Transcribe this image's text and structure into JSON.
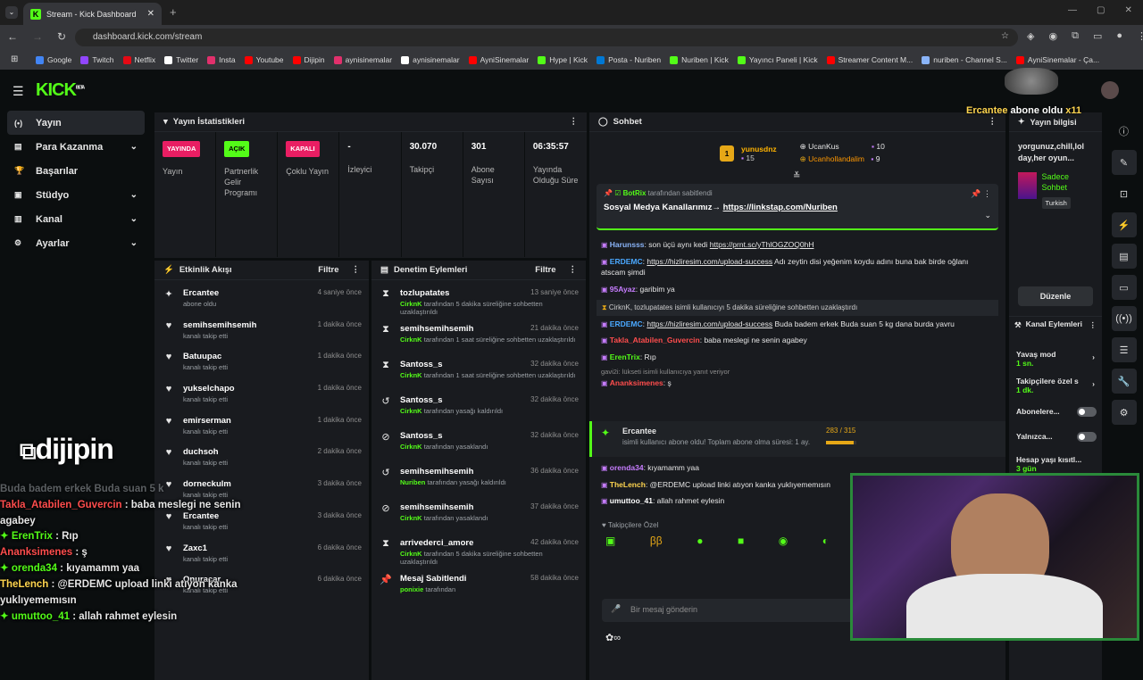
{
  "browser": {
    "tab_title": "Stream - Kick Dashboard",
    "url": "dashboard.kick.com/stream",
    "bookmarks": [
      {
        "label": "Google",
        "color": "#4285f4"
      },
      {
        "label": "Twitch",
        "color": "#9146ff"
      },
      {
        "label": "Netflix",
        "color": "#e50914"
      },
      {
        "label": "Twitter",
        "color": "#ffffff"
      },
      {
        "label": "Insta",
        "color": "#e1306c"
      },
      {
        "label": "Youtube",
        "color": "#ff0000"
      },
      {
        "label": "Dijipin",
        "color": "#ff0000"
      },
      {
        "label": "aynisinemalar",
        "color": "#e1306c"
      },
      {
        "label": "aynisinemalar",
        "color": "#ffffff"
      },
      {
        "label": "AyniSinemalar",
        "color": "#ff0000"
      },
      {
        "label": "Hype | Kick",
        "color": "#53fc18"
      },
      {
        "label": "Posta - Nuriben",
        "color": "#0078d4"
      },
      {
        "label": "Nuriben | Kick",
        "color": "#53fc18"
      },
      {
        "label": "Yayıncı Paneli | Kick",
        "color": "#53fc18"
      },
      {
        "label": "Streamer Content M...",
        "color": "#ff0000"
      },
      {
        "label": "nuriben - Channel S...",
        "color": "#8ab4f8"
      },
      {
        "label": "AyniSinemalar - Ça...",
        "color": "#ff0000"
      }
    ]
  },
  "app": {
    "logo": "KICK",
    "logo_sup": "BETA"
  },
  "sidebar": {
    "items": [
      {
        "label": "Yayın",
        "icon": "(•)",
        "active": true,
        "chevron": false
      },
      {
        "label": "Para Kazanma",
        "icon": "▤",
        "active": false,
        "chevron": true
      },
      {
        "label": "Başarılar",
        "icon": "🏆",
        "active": false,
        "chevron": false
      },
      {
        "label": "Stüdyo",
        "icon": "▣",
        "active": false,
        "chevron": true
      },
      {
        "label": "Kanal",
        "icon": "▥",
        "active": false,
        "chevron": true
      },
      {
        "label": "Ayarlar",
        "icon": "⚙",
        "active": false,
        "chevron": true
      }
    ]
  },
  "stats": {
    "title": "Yayın İstatistikleri",
    "cols": [
      {
        "badge": "YAYINDA",
        "badge_color": "#e91e63",
        "label": "Yayın"
      },
      {
        "badge": "AÇIK",
        "badge_color": "#53fc18",
        "label": "Partnerlik Gelir Programı"
      },
      {
        "badge": "KAPALI",
        "badge_color": "#e91e63",
        "label": "Çoklu Yayın"
      },
      {
        "value": "-",
        "label": "İzleyici"
      },
      {
        "value": "30.070",
        "label": "Takipçi"
      },
      {
        "value": "301",
        "label": "Abone Sayısı"
      },
      {
        "value": "06:35:57",
        "label": "Yayında Olduğu Süre"
      }
    ]
  },
  "activity": {
    "title": "Etkinlik Akışı",
    "filter": "Filtre",
    "rows": [
      {
        "name": "Ercantee",
        "sub": "abone oldu",
        "time": "4 saniye önce",
        "icon": "✦"
      },
      {
        "name": "semihsemihsemih",
        "sub": "kanalı takip etti",
        "time": "1 dakika önce",
        "icon": "♥"
      },
      {
        "name": "Batuupac",
        "sub": "kanalı takip etti",
        "time": "1 dakika önce",
        "icon": "♥"
      },
      {
        "name": "yukselchapo",
        "sub": "kanalı takip etti",
        "time": "1 dakika önce",
        "icon": "♥"
      },
      {
        "name": "emirserman",
        "sub": "kanalı takip etti",
        "time": "1 dakika önce",
        "icon": "♥"
      },
      {
        "name": "duchsoh",
        "sub": "kanalı takip etti",
        "time": "2 dakika önce",
        "icon": "♥"
      },
      {
        "name": "dorneckulm",
        "sub": "kanalı takip etti",
        "time": "3 dakika önce",
        "icon": "♥"
      },
      {
        "name": "Ercantee",
        "sub": "kanalı takip etti",
        "time": "3 dakika önce",
        "icon": "♥"
      },
      {
        "name": "Zaxc1",
        "sub": "kanalı takip etti",
        "time": "6 dakika önce",
        "icon": "♥"
      },
      {
        "name": "Onuracar",
        "sub": "kanalı takip etti",
        "time": "6 dakika önce",
        "icon": "♥"
      }
    ]
  },
  "mod": {
    "title": "Denetim Eylemleri",
    "filter": "Filtre",
    "rows": [
      {
        "name": "tozlupatates",
        "actor": "CirknK",
        "sub": "tarafından 5 dakika süreliğine sohbetten uzaklaştırıldı",
        "time": "13 saniye önce",
        "icon": "⧗"
      },
      {
        "name": "semihsemihsemih",
        "actor": "CirknK",
        "sub": "tarafından 1 saat süreliğine sohbetten uzaklaştırıldı",
        "time": "21 dakika önce",
        "icon": "⧗"
      },
      {
        "name": "Santoss_s",
        "actor": "CirknK",
        "sub": "tarafından 1 saat süreliğine sohbetten uzaklaştırıldı",
        "time": "32 dakika önce",
        "icon": "⧗"
      },
      {
        "name": "Santoss_s",
        "actor": "CirknK",
        "sub": "tarafından yasağı kaldırıldı",
        "time": "32 dakika önce",
        "icon": "↺"
      },
      {
        "name": "Santoss_s",
        "actor": "CirknK",
        "sub": "tarafından yasaklandı",
        "time": "32 dakika önce",
        "icon": "⊘"
      },
      {
        "name": "semihsemihsemih",
        "actor": "Nuriben",
        "sub": "tarafından yasağı kaldırıldı",
        "time": "36 dakika önce",
        "icon": "↺"
      },
      {
        "name": "semihsemihsemih",
        "actor": "CirknK",
        "sub": "tarafından yasaklandı",
        "time": "37 dakika önce",
        "icon": "⊘"
      },
      {
        "name": "arrivederci_amore",
        "actor": "CirknK",
        "sub": "tarafından 5 dakika süreliğine sohbetten uzaklaştırıldı",
        "time": "42 dakika önce",
        "icon": "⧗"
      },
      {
        "name": "Mesaj Sabitlendi",
        "actor": "ponixie",
        "sub": "tarafından",
        "time": "58 dakika önce",
        "icon": "📌"
      }
    ]
  },
  "chat": {
    "title": "Sohbet",
    "gifter1_rank": "1",
    "gifter1_name": "yunusdnz",
    "gifter1_count": "15",
    "gifter2_name": "UcanKus",
    "gifter2_count": "10",
    "gifter3_name": "Ucanhollandalim",
    "gifter3_count": "9",
    "pin_user": "BotRix",
    "pin_by": "tarafından sabitlendi",
    "pin_text": "Sosyal Medya Kanallarımız→ ",
    "pin_link": "https://linkstap.com/Nuriben",
    "messages": [
      {
        "user": "Harunsss",
        "color": "#8ab4f8",
        "text": ": son üçü aynı kedi ",
        "link": "https://prnt.sc/yThlOGZOQ0hH"
      },
      {
        "user": "ERDEMC",
        "color": "#4aa8ff",
        "text": ": ",
        "link": "https://hizliresim.com/upload-success",
        "after": " Adı zeytin disi yeğenim koydu adını buna bak birde oğlanı atscam şimdi"
      },
      {
        "user": "95Ayaz",
        "color": "#c77dff",
        "text": ": garibim ya"
      },
      {
        "sys": "CirknK, tozlupatates isimli kullanıcıyı 5 dakika süreliğine sohbetten uzaklaştırdı"
      },
      {
        "user": "ERDEMC",
        "color": "#4aa8ff",
        "text": ": ",
        "link": "https://hizliresim.com/upload-success",
        "after": " Buda badem erkek Buda suan 5 kg dana burda yavru"
      },
      {
        "user": "Takla_Atabilen_Guvercin",
        "color": "#ff4d4d",
        "text": ": baba meslegi ne senin agabey"
      },
      {
        "user": "ErenTrix",
        "color": "#53fc18",
        "text": ": Rıp"
      },
      {
        "reply": "gavi2i: lükseti isimli kullanıcıya yanıt veriyor"
      },
      {
        "user": "Ananksimenes",
        "color": "#ff4d4d",
        "text": ": ş"
      }
    ],
    "sub_user": "Ercantee",
    "sub_text": "isimli kullanıcı abone oldu! Toplam abone olma süresi: 1 ay.",
    "sub_progress": "283 / 315",
    "sub_progress_pct": 0.9,
    "messages2": [
      {
        "user": "orenda34",
        "color": "#c77dff",
        "text": ": kıyamamm yaa"
      },
      {
        "user": "TheLench",
        "color": "#ffd54f",
        "text": ": @ERDEMC upload linki atıyon kanka yuklıyememısın"
      },
      {
        "user": "umuttoo_41",
        "color": "#ffffff",
        "text": ": allah rahmet eylesin"
      }
    ],
    "followers_label": "Takipçilere Özel",
    "placeholder": "Bir mesaj gönderin"
  },
  "info": {
    "title": "Yayın bilgisi",
    "stream_title": "yorgunuz,chill,lol day,her oyun...",
    "category": "Sadece Sohbet",
    "language": "Turkish",
    "edit": "Düzenle",
    "channel_actions": "Kanal Eylemleri",
    "slow_mode": "Yavaş mod",
    "slow_val": "1 sn.",
    "followers_only": "Takipçilere özel s",
    "followers_val": "1 dk.",
    "subs_only": "Abonelere...",
    "emotes_only": "Yalnızca...",
    "account_age": "Hesap yaşı kısıtl...",
    "account_val": "3 gün"
  },
  "overlay": {
    "sub_alert_user": "Ercantee",
    "sub_alert_text": " abone oldu ",
    "sub_alert_count": "x11",
    "dijipin": "dijipin",
    "lines": [
      {
        "user": "Buda badem erkek Buda suan 5 k",
        "color": "#9ba0a5",
        "text": "",
        "dim": true
      },
      {
        "user": "Takla_Atabilen_Guvercin",
        "color": "#ff4d4d",
        "text": " : baba meslegi ne senin agabey"
      },
      {
        "user": "ErenTrix",
        "color": "#53fc18",
        "text": " : Rıp"
      },
      {
        "user": "Ananksimenes",
        "color": "#ff4d4d",
        "text": " : ş"
      },
      {
        "user": "orenda34",
        "color": "#53fc18",
        "text": " : kıyamamm yaa"
      },
      {
        "user": "TheLench",
        "color": "#ffd54f",
        "text": " : @ERDEMC upload linki atıyon kanka yuklıyememısın"
      },
      {
        "user": "umuttoo_41",
        "color": "#53fc18",
        "text": " : allah rahmet eylesin"
      }
    ]
  }
}
